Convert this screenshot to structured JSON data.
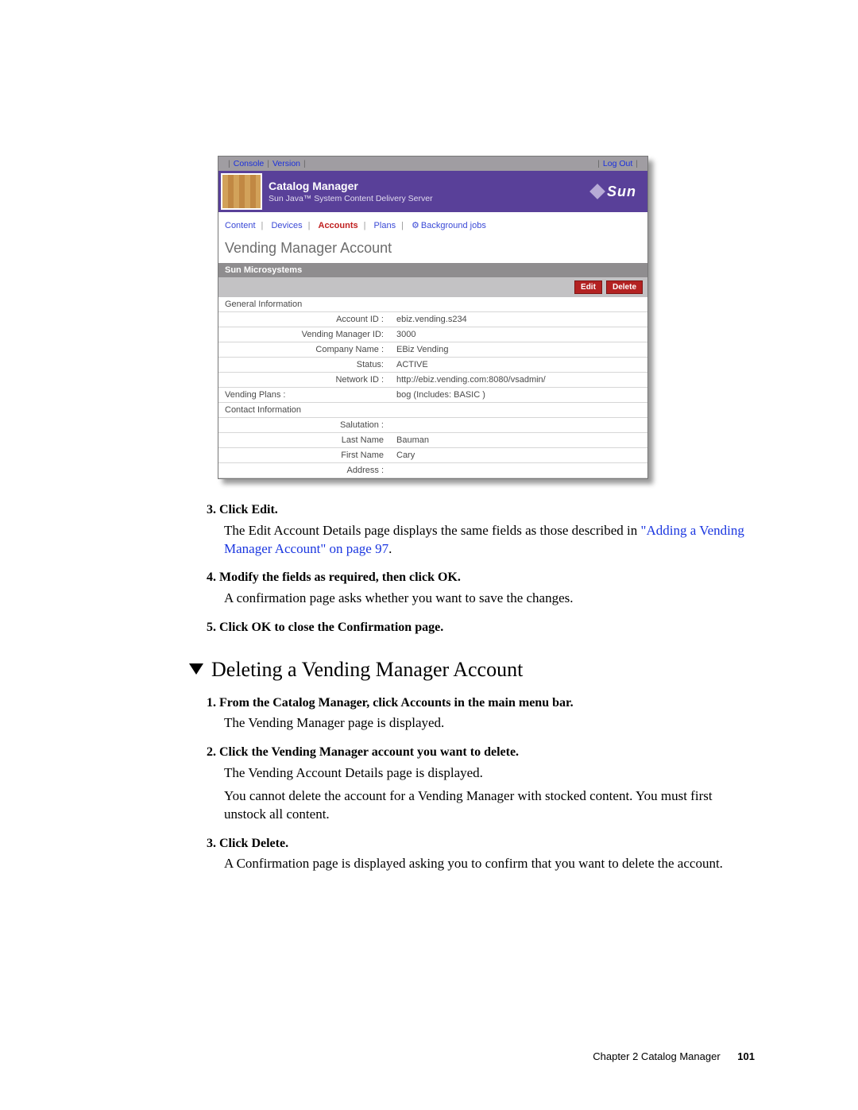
{
  "screenshot": {
    "top_links": {
      "console": "Console",
      "version": "Version",
      "logout": "Log Out"
    },
    "banner": {
      "title": "Catalog Manager",
      "subtitle": "Sun Java™ System Content Delivery Server",
      "logo_text": "Sun"
    },
    "menu": {
      "content": "Content",
      "devices": "Devices",
      "accounts": "Accounts",
      "plans": "Plans",
      "background": "Background jobs"
    },
    "page_heading": "Vending Manager Account",
    "group_bar": "Sun Microsystems",
    "buttons": {
      "edit": "Edit",
      "delete": "Delete"
    },
    "sections": {
      "general": "General Information",
      "plans": "Vending Plans :",
      "contact": "Contact Information"
    },
    "fields": {
      "account_id": {
        "label": "Account ID :",
        "value": "ebiz.vending.s234"
      },
      "vm_id": {
        "label": "Vending Manager ID:",
        "value": "3000"
      },
      "company": {
        "label": "Company Name :",
        "value": "EBiz Vending"
      },
      "status": {
        "label": "Status:",
        "value": "ACTIVE"
      },
      "network": {
        "label": "Network ID :",
        "value": "http://ebiz.vending.com:8080/vsadmin/"
      },
      "plans_value": "bog (Includes: BASIC )",
      "salutation": {
        "label": "Salutation :",
        "value": ""
      },
      "last_name": {
        "label": "Last Name",
        "value": "Bauman"
      },
      "first_name": {
        "label": "First Name",
        "value": "Cary"
      },
      "address": {
        "label": "Address :",
        "value": ""
      }
    }
  },
  "doc": {
    "s3_title": "3. Click Edit.",
    "s3_p": "The Edit Account Details page displays the same fields as those described in ",
    "s3_link": "\"Adding a Vending Manager Account\" on page 97",
    "s3_period": ".",
    "s4_title": "4. Modify the fields as required, then click OK.",
    "s4_p": "A confirmation page asks whether you want to save the changes.",
    "s5_title": "5. Click OK to close the Confirmation page.",
    "h2": "Deleting a Vending Manager Account",
    "d1_title": "1. From the Catalog Manager, click Accounts in the main menu bar.",
    "d1_p": "The Vending Manager page is displayed.",
    "d2_title": "2. Click the Vending Manager account you want to delete.",
    "d2_p1": "The Vending Account Details page is displayed.",
    "d2_p2": "You cannot delete the account for a Vending Manager with stocked content. You must first unstock all content.",
    "d3_title": "3. Click Delete.",
    "d3_p": "A Confirmation page is displayed asking you to confirm that you want to delete the account."
  },
  "footer": {
    "chapter": "Chapter 2   Catalog Manager",
    "page": "101"
  }
}
